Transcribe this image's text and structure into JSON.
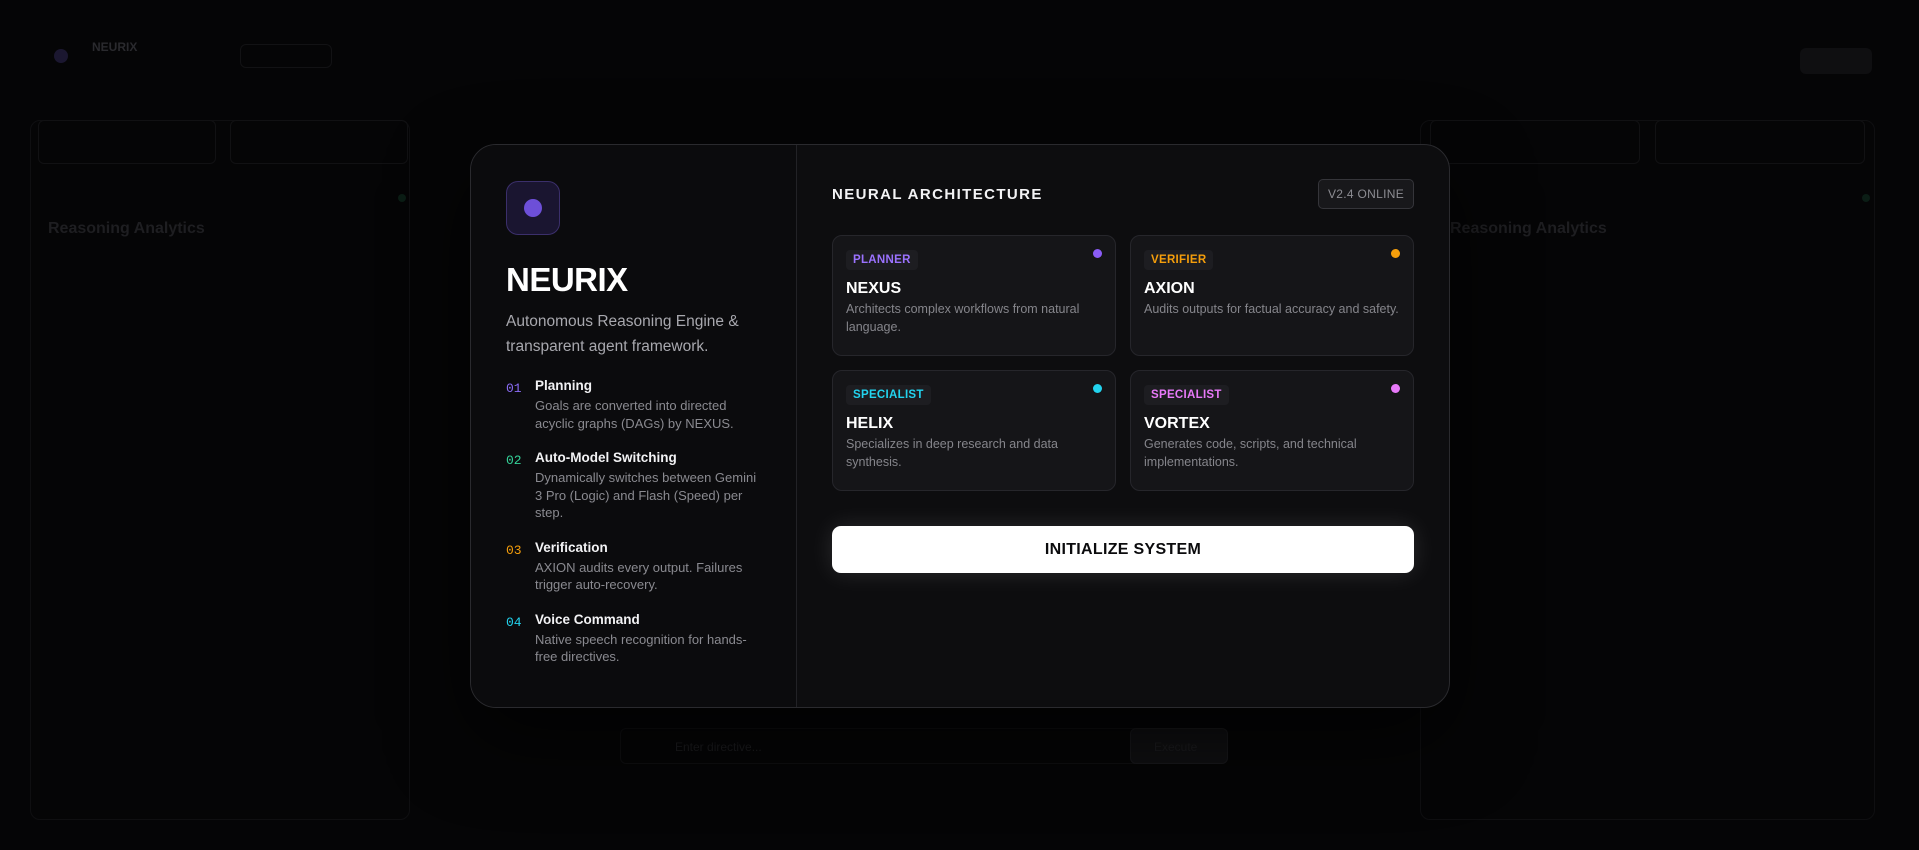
{
  "background": {
    "app_title": "NEURIX",
    "panel_title_left": "Reasoning Analytics",
    "panel_title_right": "Reasoning Analytics",
    "input_placeholder": "Enter directive...",
    "send_label": "Execute"
  },
  "modal": {
    "brand": "NEURIX",
    "tagline": "Autonomous Reasoning Engine & transparent agent framework.",
    "features": [
      {
        "num": "01",
        "title": "Planning",
        "desc": "Goals are converted into directed acyclic graphs (DAGs) by NEXUS.",
        "color": "#8b6cf6"
      },
      {
        "num": "02",
        "title": "Auto-Model Switching",
        "desc": "Dynamically switches between Gemini 3 Pro (Logic) and Flash (Speed) per step.",
        "color": "#34d399"
      },
      {
        "num": "03",
        "title": "Verification",
        "desc": "AXION audits every output. Failures trigger auto-recovery.",
        "color": "#f59e0b"
      },
      {
        "num": "04",
        "title": "Voice Command",
        "desc": "Native speech recognition for hands-free directives.",
        "color": "#22d3ee"
      }
    ],
    "section_title": "NEURAL ARCHITECTURE",
    "version": "V2.4 ONLINE",
    "agents": [
      {
        "role": "PLANNER",
        "name": "NEXUS",
        "desc": "Architects complex workflows from natural language.",
        "color": "#9b72ff"
      },
      {
        "role": "VERIFIER",
        "name": "AXION",
        "desc": "Audits outputs for factual accuracy and safety.",
        "color": "#f59e0b"
      },
      {
        "role": "SPECIALIST",
        "name": "HELIX",
        "desc": "Specializes in deep research and data synthesis.",
        "color": "#22d3ee"
      },
      {
        "role": "SPECIALIST",
        "name": "VORTEX",
        "desc": "Generates code, scripts, and technical implementations.",
        "color": "#e879f9"
      }
    ],
    "init_button": "INITIALIZE SYSTEM"
  }
}
